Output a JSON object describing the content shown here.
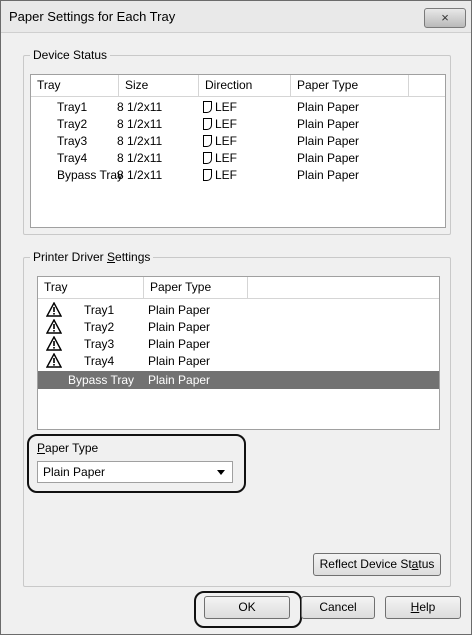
{
  "window": {
    "title": "Paper Settings for Each Tray",
    "close_icon": "×"
  },
  "device_status": {
    "label": "Device Status",
    "columns": [
      "Tray",
      "Size",
      "Direction",
      "Paper Type"
    ],
    "rows": [
      {
        "tray": "Tray1",
        "size": "8 1/2x11",
        "direction": "LEF",
        "paper_type": "Plain Paper"
      },
      {
        "tray": "Tray2",
        "size": "8 1/2x11",
        "direction": "LEF",
        "paper_type": "Plain Paper"
      },
      {
        "tray": "Tray3",
        "size": "8 1/2x11",
        "direction": "LEF",
        "paper_type": "Plain Paper"
      },
      {
        "tray": "Tray4",
        "size": "8 1/2x11",
        "direction": "LEF",
        "paper_type": "Plain Paper"
      },
      {
        "tray": "Bypass Tray",
        "size": "8 1/2x11",
        "direction": "LEF",
        "paper_type": "Plain Paper"
      }
    ]
  },
  "driver_settings": {
    "label_pre": "Printer Driver ",
    "label_u": "S",
    "label_post": "ettings",
    "columns": [
      "Tray",
      "Paper Type"
    ],
    "rows": [
      {
        "tray": "Tray1",
        "paper_type": "Plain Paper",
        "icon": "warning-icon"
      },
      {
        "tray": "Tray2",
        "paper_type": "Plain Paper",
        "icon": "warning-icon"
      },
      {
        "tray": "Tray3",
        "paper_type": "Plain Paper",
        "icon": "warning-icon"
      },
      {
        "tray": "Tray4",
        "paper_type": "Plain Paper",
        "icon": "warning-icon"
      }
    ],
    "selected_row": {
      "tray": "Bypass Tray",
      "paper_type": "Plain Paper"
    },
    "paper_type_label_u": "P",
    "paper_type_label_post": "aper Type",
    "paper_type_value": "Plain Paper"
  },
  "buttons": {
    "reflect_pre": "Reflect Device St",
    "reflect_u": "a",
    "reflect_post": "tus",
    "ok": "OK",
    "cancel": "Cancel",
    "help_u": "H",
    "help_post": "elp"
  }
}
